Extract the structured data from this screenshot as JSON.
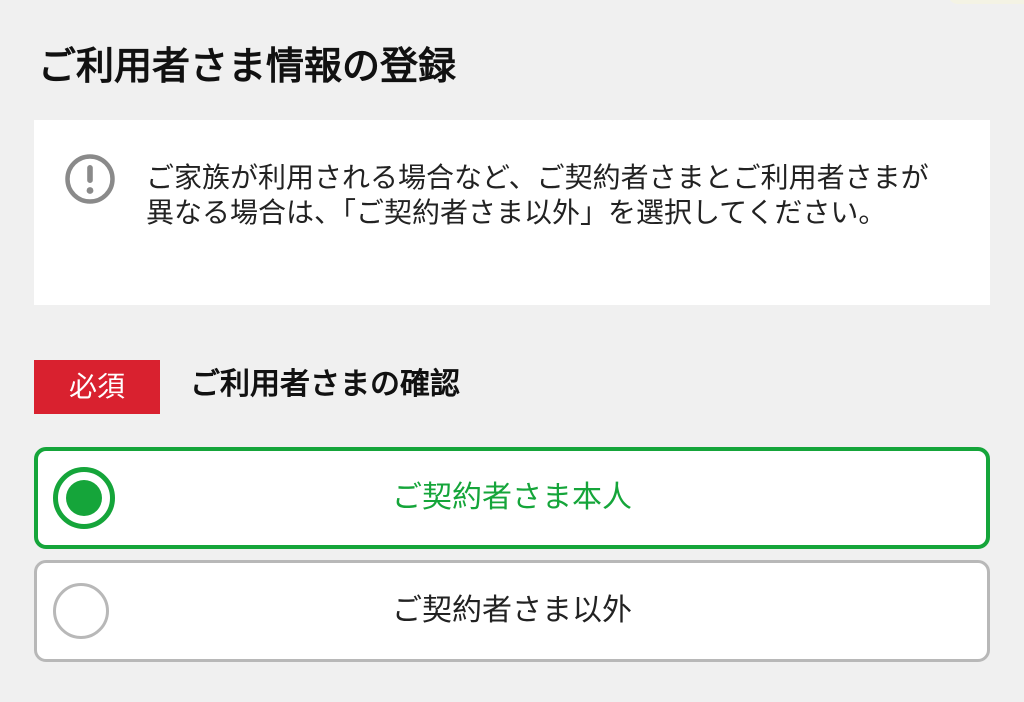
{
  "page": {
    "title": "ご利用者さま情報の登録"
  },
  "notice": {
    "icon": "exclamation-circle-icon",
    "text": "ご家族が利用される場合など、ご契約者さまとご利用者さまが異なる場合は、「ご契約者さま以外」を選択してください。"
  },
  "section": {
    "required_badge": "必須",
    "label": "ご利用者さまの確認"
  },
  "options": [
    {
      "label": "ご契約者さま本人",
      "selected": true
    },
    {
      "label": "ご契約者さま以外",
      "selected": false
    }
  ],
  "colors": {
    "accent_green": "#15a53a",
    "required_red": "#d9212f",
    "background": "#f0f0f0"
  }
}
